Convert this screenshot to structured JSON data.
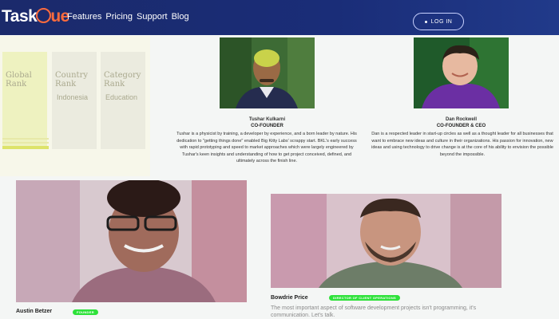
{
  "nav": {
    "logo_part1": "Task",
    "logo_part2": "ue",
    "links": [
      "Features",
      "Pricing",
      "Support",
      "Blog"
    ],
    "login": "LOG IN"
  },
  "ranks": [
    {
      "title": "Global Rank",
      "value": ""
    },
    {
      "title": "Country Rank",
      "value": "Indonesia"
    },
    {
      "title": "Category Rank",
      "value": "Education"
    }
  ],
  "team_top": [
    {
      "name": "Tushar Kulkarni",
      "role": "CO-FOUNDER",
      "bio": "Tushar is a physicist by training, a developer by experience, and a born leader by nature. His dedication to \"getting things done\" enabled Big Kitty Labs' scrappy start. BKL's early success with rapid prototyping and speed to market approaches which were largely engineered by Tushar's keen insights and understanding of how to get project conceived, defined, and ultimately across the finish line."
    },
    {
      "name": "Dan Rockwell",
      "role": "CO-FOUNDER & CEO",
      "bio": "Dan is a respected leader in start-up circles as well as a thought leader for all businesses that want to embrace new ideas and culture in their organizations. His passion for innovation, new ideas and using technology to drive change is at the core of his ability to envision the possible beyond the impossible."
    }
  ],
  "team_bottom": [
    {
      "name": "Austin Betzer",
      "badge": "FOUNDER",
      "bio": ""
    },
    {
      "name": "Bowdrie Price",
      "badge": "DIRECTOR OF CLIENT OPERATIONS",
      "bio": "The most important aspect of software development projects isn't programming, it's communication. Let's talk."
    }
  ],
  "colors": {
    "nav": "#1b2a6b",
    "accent": "#ff6b3d",
    "badge": "#2ee23a"
  }
}
